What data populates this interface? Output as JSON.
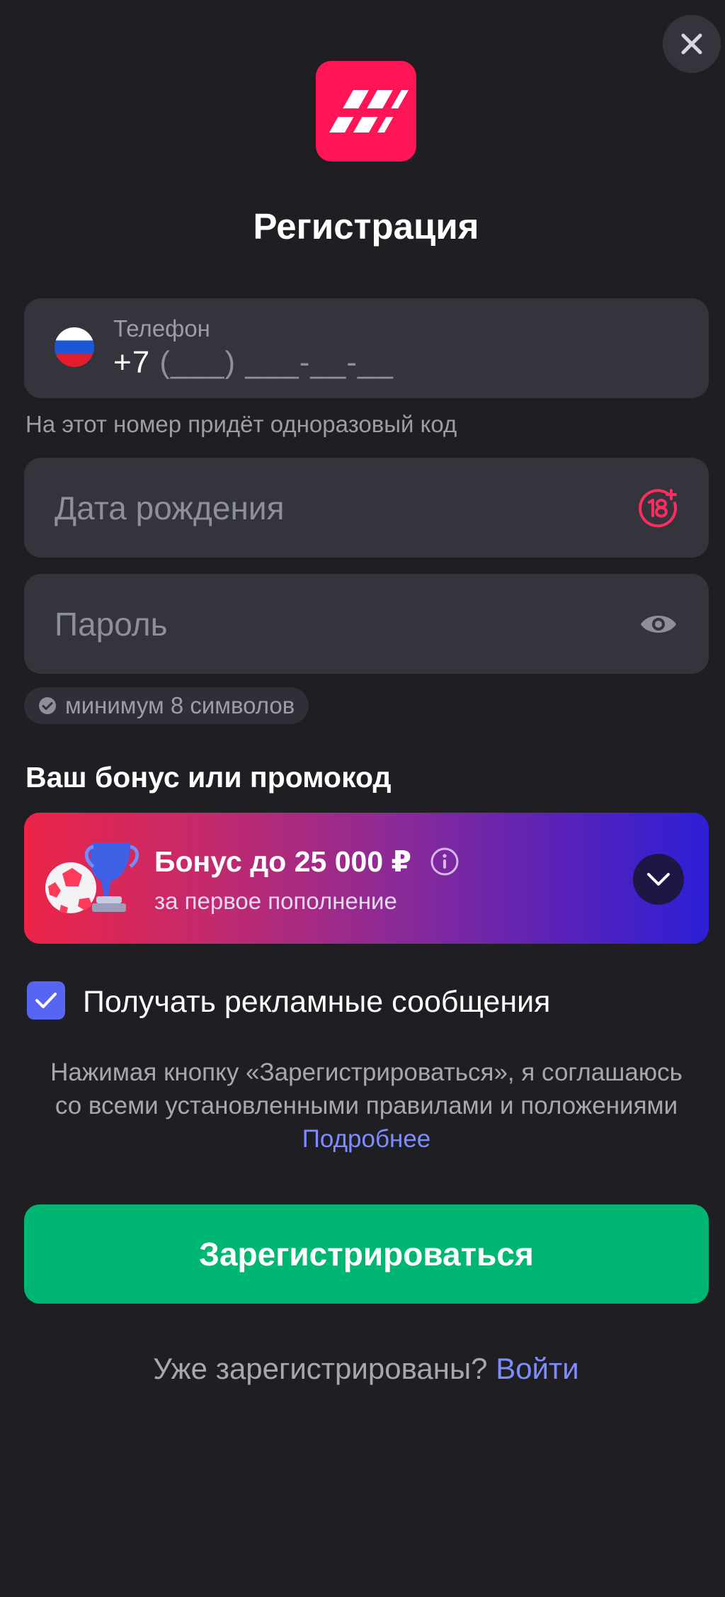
{
  "title": "Регистрация",
  "phone": {
    "label": "Телефон",
    "prefix": "+7",
    "mask": "(___) ___-__-__",
    "hint": "На этот номер придёт одноразовый код",
    "country_icon": "russia-flag-icon"
  },
  "birth_date": {
    "placeholder": "Дата рождения",
    "icon": "age-18-plus-icon"
  },
  "password": {
    "placeholder": "Пароль",
    "icon": "eye-icon",
    "rule": "минимум 8 символов"
  },
  "bonus": {
    "section_title": "Ваш бонус или промокод",
    "title": "Бонус до 25 000 ₽",
    "subtitle": "за первое пополнение",
    "icons": [
      "soccer-ball-icon",
      "trophy-icon",
      "info-icon",
      "chevron-down-icon"
    ]
  },
  "marketing": {
    "label": "Получать рекламные сообщения",
    "checked": true
  },
  "terms": {
    "text": "Нажимая кнопку «Зарегистрироваться», я соглашаюсь со всеми установленными правилами и положениями",
    "link": "Подробнее"
  },
  "submit_label": "Зарегистрироваться",
  "login": {
    "question": "Уже зарегистрированы?",
    "link": "Войти"
  },
  "colors": {
    "background": "#1e1e23",
    "field": "#33343c",
    "brand": "#ff1556",
    "primary": "#00b673",
    "link": "#7f8cff",
    "checkbox": "#5865f2"
  }
}
